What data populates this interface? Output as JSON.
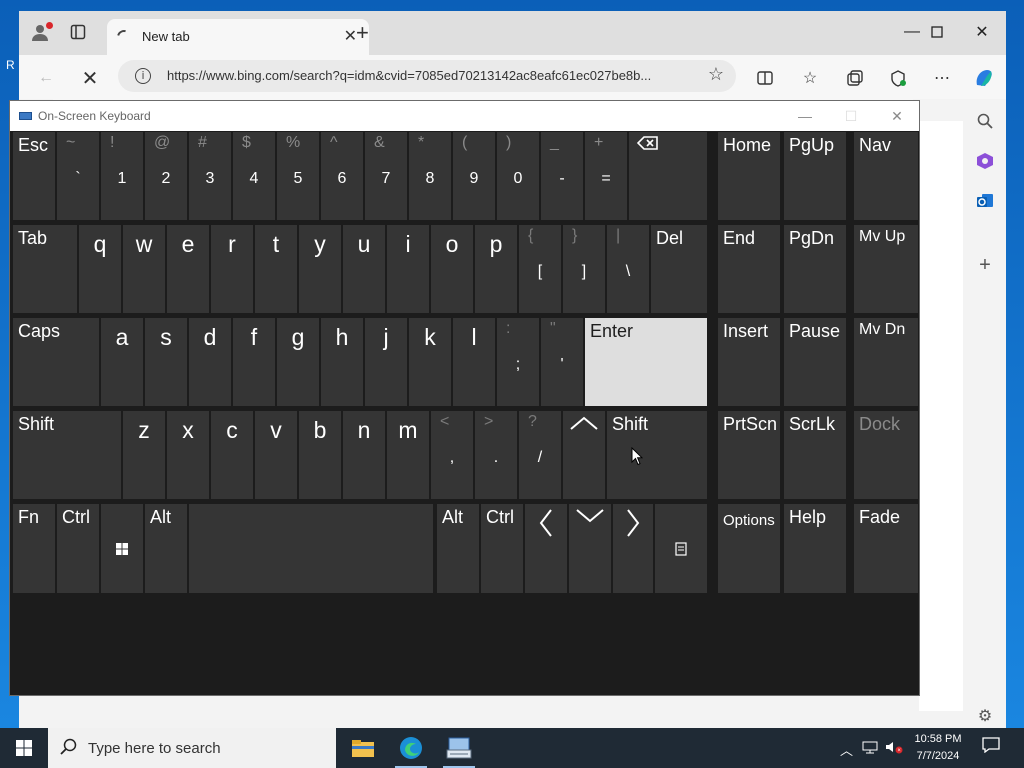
{
  "desktop": {
    "fragment_text": "R"
  },
  "browser": {
    "tab": {
      "title": "New tab"
    },
    "address": {
      "url": "https://www.bing.com/search?q=idm&cvid=7085ed70213142ac8eafc61ec027be8b..."
    }
  },
  "osk": {
    "title": "On-Screen Keyboard",
    "row1": [
      {
        "top": "~",
        "bottom": "`"
      },
      {
        "top": "!",
        "bottom": "1"
      },
      {
        "top": "@",
        "bottom": "2"
      },
      {
        "top": "#",
        "bottom": "3"
      },
      {
        "top": "$",
        "bottom": "4"
      },
      {
        "top": "%",
        "bottom": "5"
      },
      {
        "top": "^",
        "bottom": "6"
      },
      {
        "top": "&",
        "bottom": "7"
      },
      {
        "top": "*",
        "bottom": "8"
      },
      {
        "top": "(",
        "bottom": "9"
      },
      {
        "top": ")",
        "bottom": "0"
      },
      {
        "top": "_",
        "bottom": "-"
      },
      {
        "top": "+",
        "bottom": "="
      }
    ],
    "row2_letters": [
      "q",
      "w",
      "e",
      "r",
      "t",
      "y",
      "u",
      "i",
      "o",
      "p"
    ],
    "row2_symbols": [
      {
        "top": "{",
        "bottom": "["
      },
      {
        "top": "}",
        "bottom": "]"
      },
      {
        "top": "|",
        "bottom": "\\"
      }
    ],
    "row3_letters": [
      "a",
      "s",
      "d",
      "f",
      "g",
      "h",
      "j",
      "k",
      "l"
    ],
    "row3_symbols": [
      {
        "top": ":",
        "bottom": ";"
      },
      {
        "top": "\"",
        "bottom": "'"
      }
    ],
    "row4_letters": [
      "z",
      "x",
      "c",
      "v",
      "b",
      "n",
      "m"
    ],
    "row4_symbols": [
      {
        "top": "<",
        "bottom": ","
      },
      {
        "top": ">",
        "bottom": "."
      },
      {
        "top": "?",
        "bottom": "/"
      }
    ],
    "labels": {
      "esc": "Esc",
      "tab": "Tab",
      "del": "Del",
      "caps": "Caps",
      "enter": "Enter",
      "shift": "Shift",
      "fn": "Fn",
      "ctrl": "Ctrl",
      "alt": "Alt",
      "home": "Home",
      "pgup": "PgUp",
      "nav": "Nav",
      "end": "End",
      "pgdn": "PgDn",
      "mvup": "Mv Up",
      "insert": "Insert",
      "pause": "Pause",
      "mvdn": "Mv Dn",
      "prtscn": "PrtScn",
      "scrlk": "ScrLk",
      "dock": "Dock",
      "options": "Options",
      "help": "Help",
      "fade": "Fade"
    }
  },
  "taskbar": {
    "search_placeholder": "Type here to search",
    "time": "10:58 PM",
    "date": "7/7/2024"
  }
}
